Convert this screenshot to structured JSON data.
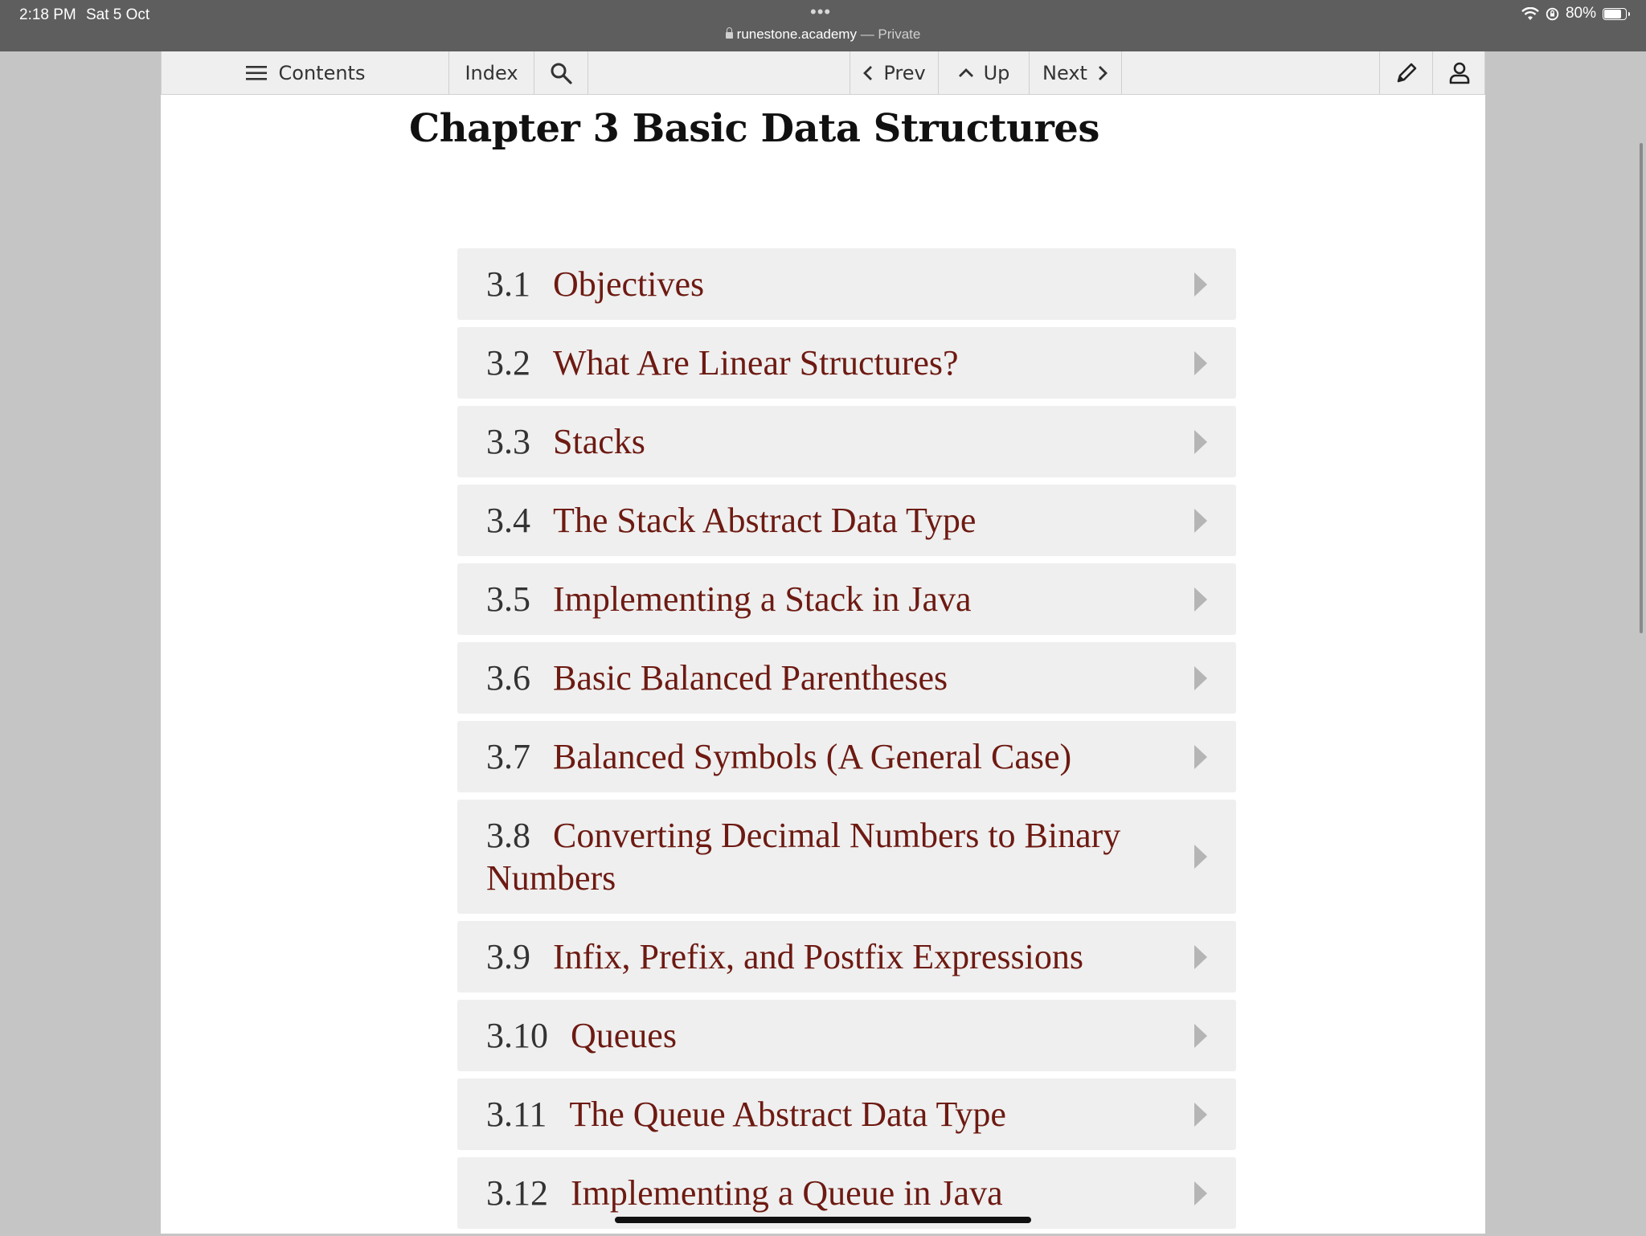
{
  "status_bar": {
    "time": "2:18 PM",
    "date": "Sat 5 Oct",
    "dots": "•••",
    "url": "runestone.academy",
    "private_label": " — Private",
    "battery": "80%"
  },
  "toolbar": {
    "contents": "Contents",
    "index": "Index",
    "prev": "Prev",
    "up": "Up",
    "next": "Next"
  },
  "chapter": {
    "title": "Chapter 3 Basic Data Structures"
  },
  "toc": [
    {
      "num": "3.1",
      "title": "Objectives"
    },
    {
      "num": "3.2",
      "title": "What Are Linear Structures?"
    },
    {
      "num": "3.3",
      "title": "Stacks"
    },
    {
      "num": "3.4",
      "title": "The Stack Abstract Data Type"
    },
    {
      "num": "3.5",
      "title": "Implementing a Stack in Java"
    },
    {
      "num": "3.6",
      "title": "Basic Balanced Parentheses"
    },
    {
      "num": "3.7",
      "title": "Balanced Symbols (A General Case)"
    },
    {
      "num": "3.8",
      "title": "Converting Decimal Numbers to Binary Numbers"
    },
    {
      "num": "3.9",
      "title": "Infix, Prefix, and Postfix Expressions"
    },
    {
      "num": "3.10",
      "title": "Queues"
    },
    {
      "num": "3.11",
      "title": "The Queue Abstract Data Type"
    },
    {
      "num": "3.12",
      "title": "Implementing a Queue in Java"
    }
  ],
  "colors": {
    "link": "#6d1a12",
    "item_bg": "#efefef",
    "chrome": "#5e5e5e"
  }
}
